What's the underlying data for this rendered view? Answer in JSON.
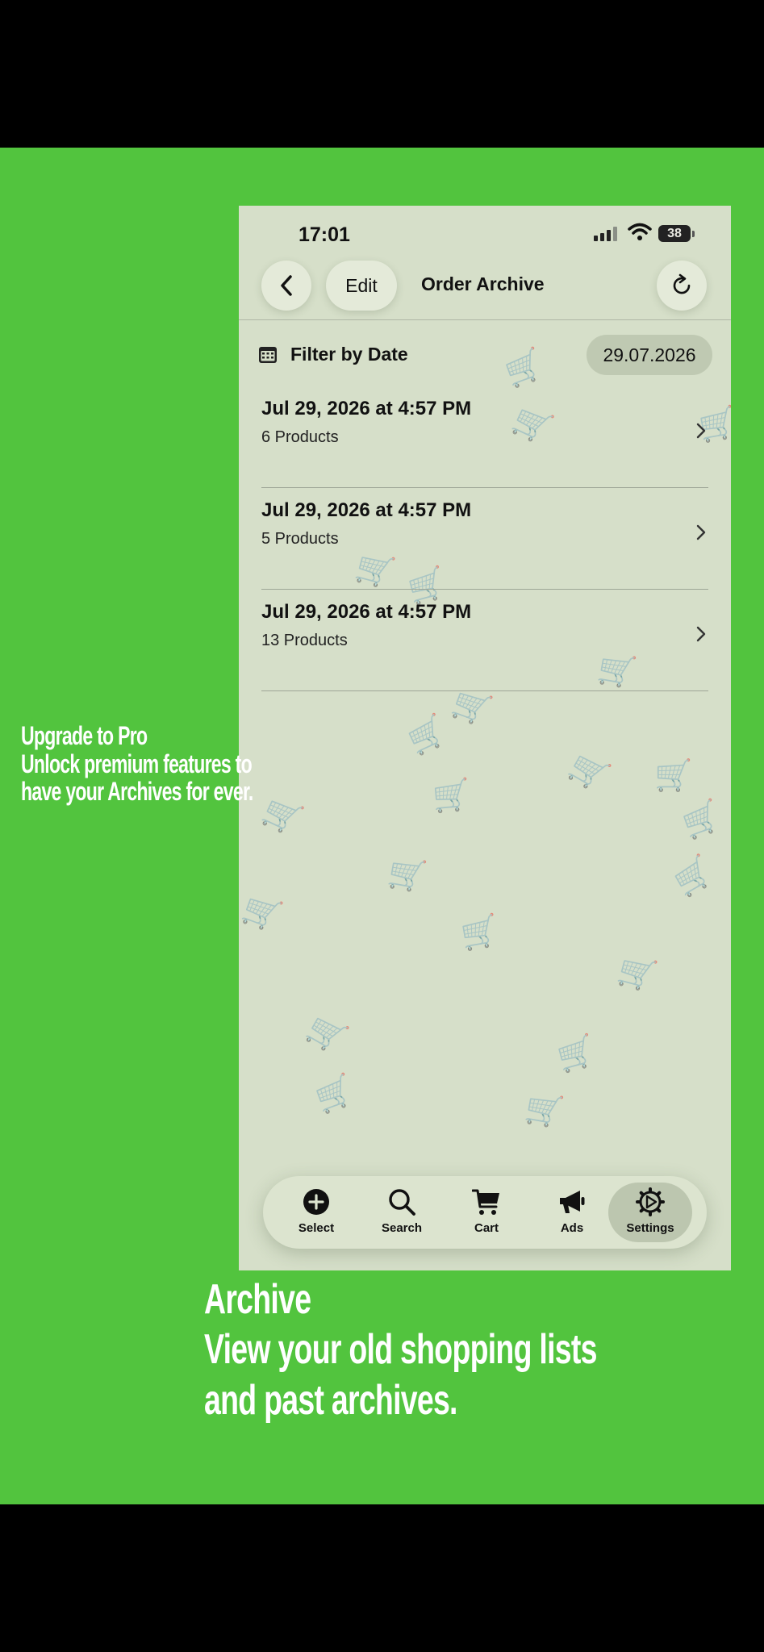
{
  "status_bar": {
    "time": "17:01",
    "battery": "38"
  },
  "nav": {
    "edit_label": "Edit",
    "title": "Order Archive"
  },
  "filter": {
    "label": "Filter by Date",
    "date": "29.07.2026"
  },
  "orders": [
    {
      "title": "Jul 29, 2026 at 4:57 PM",
      "subtitle": "6 Products"
    },
    {
      "title": "Jul 29, 2026 at 4:57 PM",
      "subtitle": "5 Products"
    },
    {
      "title": "Jul 29, 2026 at 4:57 PM",
      "subtitle": "13 Products"
    }
  ],
  "tabs": [
    {
      "label": "Select",
      "icon": "plus-circle-icon",
      "active": false
    },
    {
      "label": "Search",
      "icon": "magnifier-icon",
      "active": false
    },
    {
      "label": "Cart",
      "icon": "cart-icon",
      "active": false
    },
    {
      "label": "Ads",
      "icon": "megaphone-icon",
      "active": false
    },
    {
      "label": "Settings",
      "icon": "gear-icon",
      "active": true
    }
  ],
  "promo": {
    "upgrade_lines": [
      "Upgrade to Pro",
      "Unlock premium features to",
      "have your Archives for ever."
    ],
    "archive_lines": [
      "Archive",
      "View your old shopping lists",
      "and past archives."
    ]
  },
  "colors": {
    "background": "#52c43e",
    "screen": "#d6dfc9",
    "active_tab": "#bcc6af",
    "text": "#111111"
  }
}
